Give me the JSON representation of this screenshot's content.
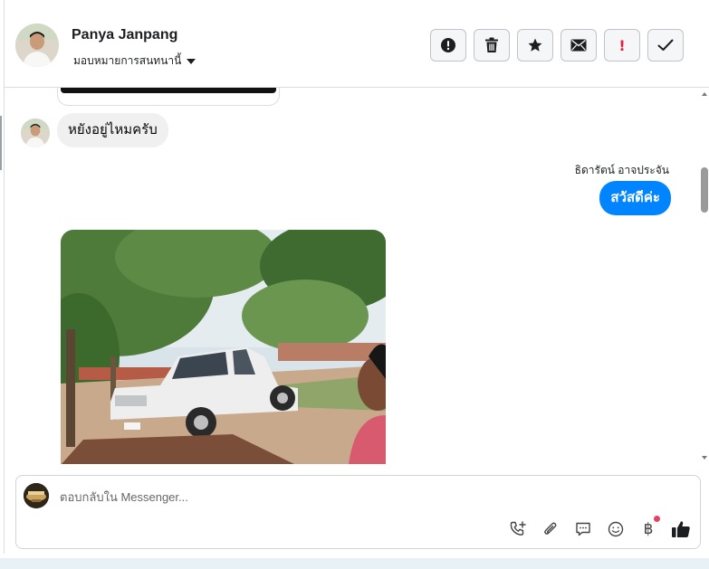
{
  "header": {
    "contact_name": "Panya Janpang",
    "assign_label": "มอบหมายการสนทนานี้",
    "toolbar": [
      {
        "name": "report-spam-button",
        "icon": "alert-circle-icon"
      },
      {
        "name": "delete-button",
        "icon": "trash-icon"
      },
      {
        "name": "star-button",
        "icon": "star-icon"
      },
      {
        "name": "mark-unread-button",
        "icon": "envelope-icon"
      },
      {
        "name": "mark-important-button",
        "icon": "exclamation-icon"
      },
      {
        "name": "mark-done-button",
        "icon": "check-icon"
      }
    ]
  },
  "thread": {
    "messages": [
      {
        "direction": "incoming",
        "text": "หยังอยู่ไหมครับ"
      },
      {
        "direction": "outgoing",
        "sender": "ธิดารัตน์ อาจประจัน",
        "text": "สวัสดีค่ะ"
      },
      {
        "direction": "incoming",
        "type": "photo",
        "icon": "photo-truck-yard"
      }
    ]
  },
  "composer": {
    "placeholder": "ตอบกลับใน Messenger...",
    "icons": [
      "call-add-icon",
      "paperclip-icon",
      "saved-reply-icon",
      "emoji-icon",
      "payment-baht-icon",
      "like-thumb-icon"
    ],
    "baht_symbol": "฿"
  },
  "colors": {
    "outgoing_bubble": "#0084ff",
    "incoming_bubble": "#f0f0f0",
    "notification_dot": "#e4445f",
    "important_red": "#e41e3f"
  }
}
